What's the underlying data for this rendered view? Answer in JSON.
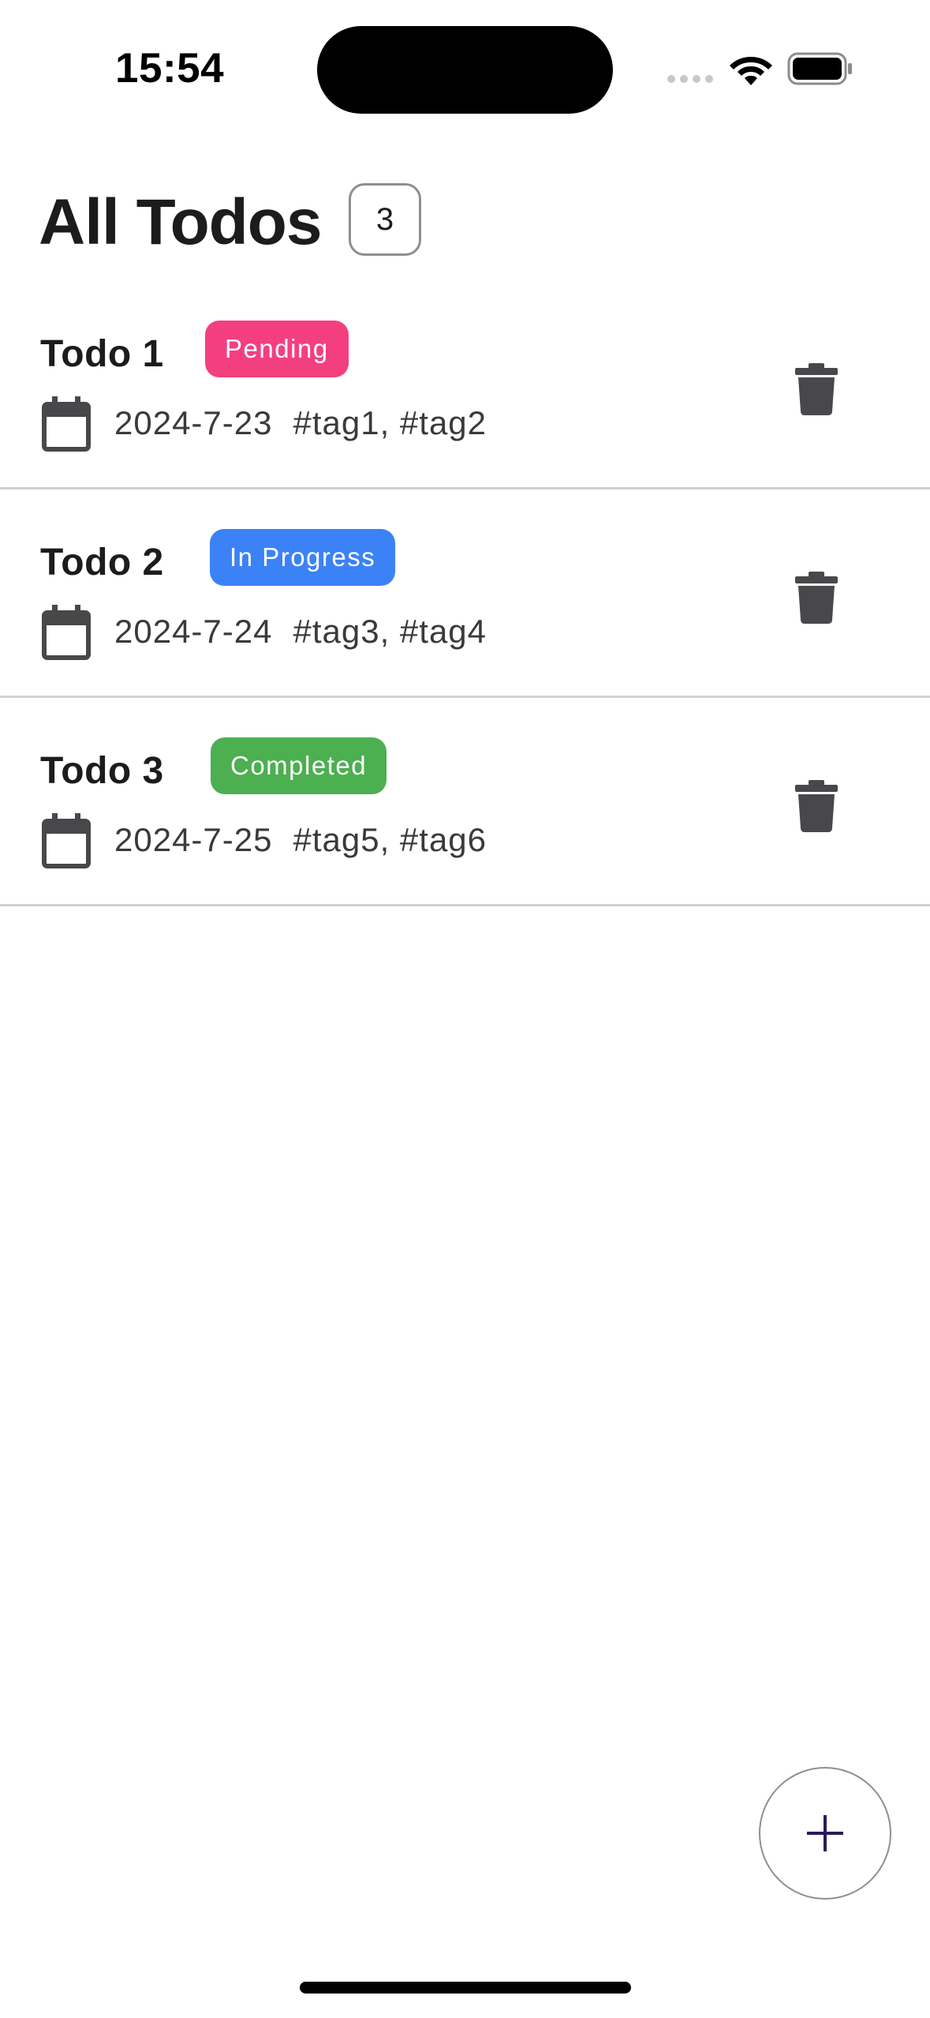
{
  "status_bar": {
    "time": "15:54"
  },
  "header": {
    "title": "All Todos",
    "count": "3"
  },
  "todos": [
    {
      "title": "Todo 1",
      "status": "Pending",
      "status_color": "#f43f7f",
      "date": "2024-7-23",
      "tags": "#tag1, #tag2"
    },
    {
      "title": "Todo 2",
      "status": "In Progress",
      "status_color": "#3b82f6",
      "date": "2024-7-24",
      "tags": "#tag3, #tag4"
    },
    {
      "title": "Todo 3",
      "status": "Completed",
      "status_color": "#4caf50",
      "date": "2024-7-25",
      "tags": "#tag5, #tag6"
    }
  ],
  "fab": {
    "icon": "plus-icon",
    "icon_color": "#2a1a5e"
  },
  "icons": {
    "calendar": "calendar-icon",
    "delete": "trash-icon",
    "wifi": "wifi-icon",
    "battery": "battery-icon"
  },
  "colors": {
    "text_primary": "#1c1c1e",
    "icon_dark": "#48484a",
    "divider": "#d1d1d6"
  }
}
